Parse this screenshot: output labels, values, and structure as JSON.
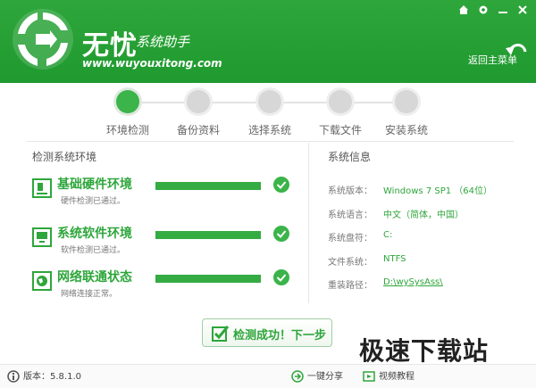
{
  "header": {
    "title": "无忧",
    "subtitle": "系统助手",
    "url": "www.wuyouxitong.com",
    "back_label": "返回主菜单"
  },
  "window_controls": [
    "home-icon",
    "gear-icon",
    "minimize-icon",
    "close-icon"
  ],
  "steps": [
    {
      "label": "环境检测",
      "active": true
    },
    {
      "label": "备份资料",
      "active": false
    },
    {
      "label": "选择系统",
      "active": false
    },
    {
      "label": "下载文件",
      "active": false
    },
    {
      "label": "安装系统",
      "active": false
    }
  ],
  "left": {
    "title": "检测系统环境",
    "items": [
      {
        "title": "基础硬件环境",
        "sub": "硬件检测已通过。",
        "icon": "hardware-icon",
        "progress": 1.0
      },
      {
        "title": "系统软件环境",
        "sub": "软件检测已通过。",
        "icon": "software-icon",
        "progress": 1.0
      },
      {
        "title": "网络联通状态",
        "sub": "网络连接正常。",
        "icon": "network-icon",
        "progress": 1.0
      }
    ]
  },
  "right": {
    "title": "系统信息",
    "rows": [
      {
        "key": "系统版本：",
        "value": "Windows 7 SP1 （64位）"
      },
      {
        "key": "系统语言：",
        "value": "中文（简体，中国）"
      },
      {
        "key": "系统盘符：",
        "value": "C:"
      },
      {
        "key": "文件系统：",
        "value": "NTFS"
      },
      {
        "key": "重装路径：",
        "value": "D:\\wySysAss\\"
      }
    ]
  },
  "next_button": "检测成功！下一步",
  "footer": {
    "version": "版本：5.8.1.0",
    "share": "一键分享",
    "tutorial": "视频教程"
  },
  "watermark": "极速下载站",
  "colors": {
    "accent": "#2ea63b",
    "header": "#1f9a2f"
  }
}
